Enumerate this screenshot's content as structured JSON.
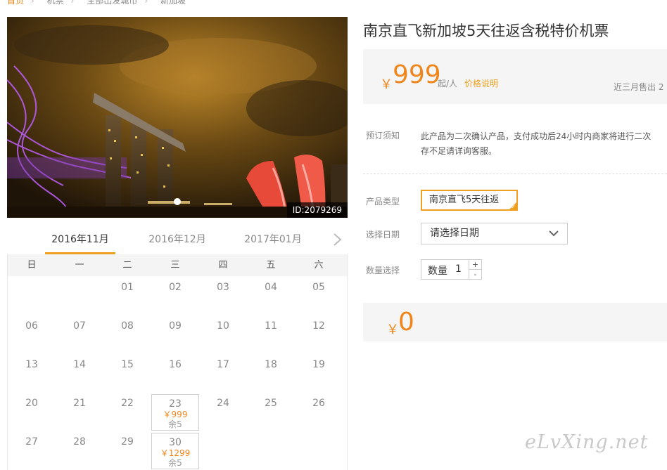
{
  "breadcrumb": [
    {
      "label": "首页",
      "home": true
    },
    {
      "label": "机票"
    },
    {
      "label": "全部出发城市"
    },
    {
      "label": "新加坡"
    }
  ],
  "hero": {
    "image_id": "ID:2079269"
  },
  "calendar": {
    "tabs": [
      "2016年11月",
      "2016年12月",
      "2017年01月"
    ],
    "active_tab": 0,
    "weekdays": [
      "日",
      "一",
      "二",
      "三",
      "四",
      "五",
      "六"
    ],
    "weeks": [
      [
        {
          "d": ""
        },
        {
          "d": ""
        },
        {
          "d": "01"
        },
        {
          "d": "02"
        },
        {
          "d": "03"
        },
        {
          "d": "04"
        },
        {
          "d": "05"
        }
      ],
      [
        {
          "d": "06"
        },
        {
          "d": "07"
        },
        {
          "d": "08"
        },
        {
          "d": "09"
        },
        {
          "d": "10"
        },
        {
          "d": "11"
        },
        {
          "d": "12"
        }
      ],
      [
        {
          "d": "13"
        },
        {
          "d": "14"
        },
        {
          "d": "15"
        },
        {
          "d": "16"
        },
        {
          "d": "17"
        },
        {
          "d": "18"
        },
        {
          "d": "19"
        }
      ],
      [
        {
          "d": "20"
        },
        {
          "d": "21"
        },
        {
          "d": "22"
        },
        {
          "d": "23",
          "price": "￥999",
          "stock": "余5"
        },
        {
          "d": "24"
        },
        {
          "d": "25"
        },
        {
          "d": "26"
        }
      ],
      [
        {
          "d": "27"
        },
        {
          "d": "28"
        },
        {
          "d": "29"
        },
        {
          "d": "30",
          "price": "￥1299",
          "stock": "余5"
        },
        {
          "d": ""
        },
        {
          "d": ""
        },
        {
          "d": ""
        }
      ]
    ]
  },
  "product": {
    "title": "南京直飞新加坡5天往返含税特价机票",
    "price": {
      "currency": "￥",
      "amount": "999",
      "unit": "起/人",
      "explain_link": "价格说明",
      "sold": "近三月售出 2"
    },
    "notice": {
      "label": "预订须知",
      "line1": "此产品为二次确认产品，支付成功后24小时内商家将进行二次",
      "line2": "存不足请详询客服。"
    },
    "type": {
      "label": "产品类型",
      "option": "南京直飞5天往返"
    },
    "date": {
      "label": "选择日期",
      "placeholder": "请选择日期"
    },
    "quantity": {
      "label": "数量选择",
      "inner_label": "数量",
      "value": "1",
      "plus": "+",
      "minus": "-"
    },
    "total": {
      "currency": "￥",
      "amount": "0"
    }
  },
  "watermark": "eLvXing.net",
  "colors": {
    "accent": "#f08519",
    "highlight": "#f0a020"
  }
}
